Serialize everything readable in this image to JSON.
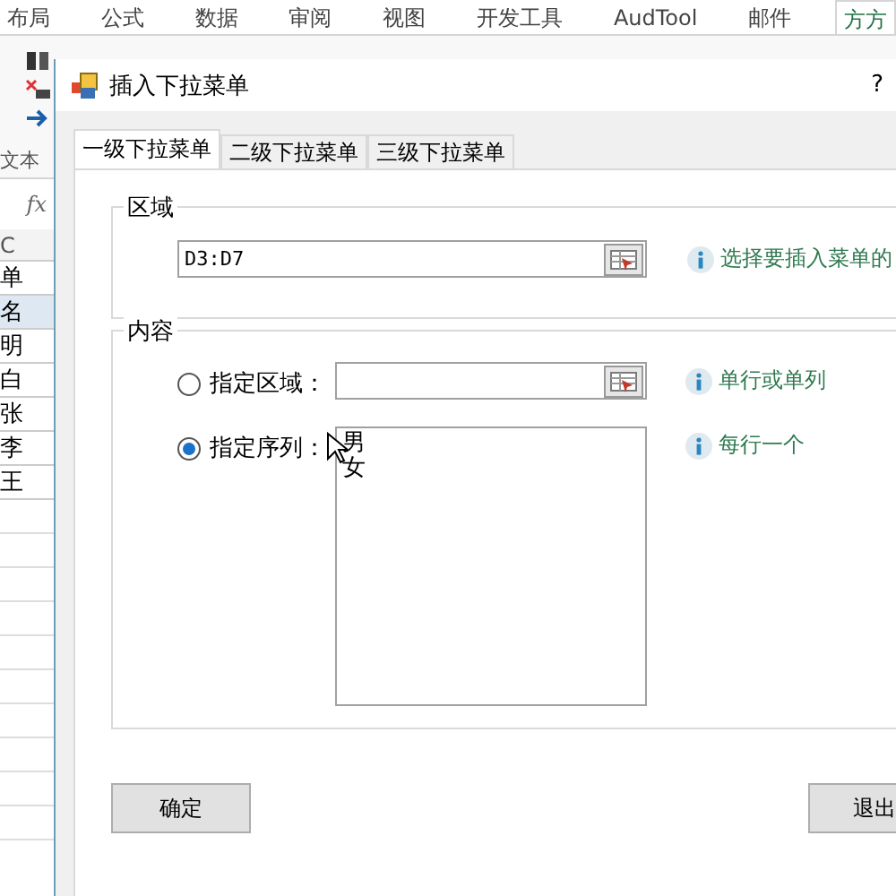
{
  "ribbon": {
    "tabs": [
      {
        "label": "布局",
        "selected": false
      },
      {
        "label": "公式",
        "selected": false
      },
      {
        "label": "数据",
        "selected": false
      },
      {
        "label": "审阅",
        "selected": false
      },
      {
        "label": "视图",
        "selected": false
      },
      {
        "label": "开发工具",
        "selected": false
      },
      {
        "label": "AudTool",
        "selected": false
      },
      {
        "label": "邮件",
        "selected": false
      },
      {
        "label": "方方",
        "selected": true
      }
    ],
    "group_label": "文本"
  },
  "sheet": {
    "formula_label": "fx",
    "column": "C",
    "cells": [
      {
        "text": "单",
        "selected": false
      },
      {
        "text": "名",
        "selected": true
      },
      {
        "text": "明",
        "selected": false
      },
      {
        "text": "白",
        "selected": false
      },
      {
        "text": "张",
        "selected": false
      },
      {
        "text": "李",
        "selected": false
      },
      {
        "text": "王",
        "selected": false
      }
    ]
  },
  "dialog": {
    "title": "插入下拉菜单",
    "help": "?",
    "tabs": [
      {
        "label": "一级下拉菜单",
        "selected": true
      },
      {
        "label": "二级下拉菜单",
        "selected": false
      },
      {
        "label": "三级下拉菜单",
        "selected": false
      }
    ],
    "region_group": {
      "title": "区域",
      "value": "D3:D7",
      "hint": "选择要插入菜单的"
    },
    "content_group": {
      "title": "内容",
      "options": [
        {
          "kind": "field",
          "label": "指定区域：",
          "selected": false,
          "hint": "单行或单列"
        },
        {
          "kind": "list",
          "label": "指定序列：",
          "selected": true,
          "lines": [
            "男",
            "女"
          ],
          "hint": "每行一个"
        }
      ]
    },
    "buttons": [
      "确定",
      "退出"
    ]
  }
}
